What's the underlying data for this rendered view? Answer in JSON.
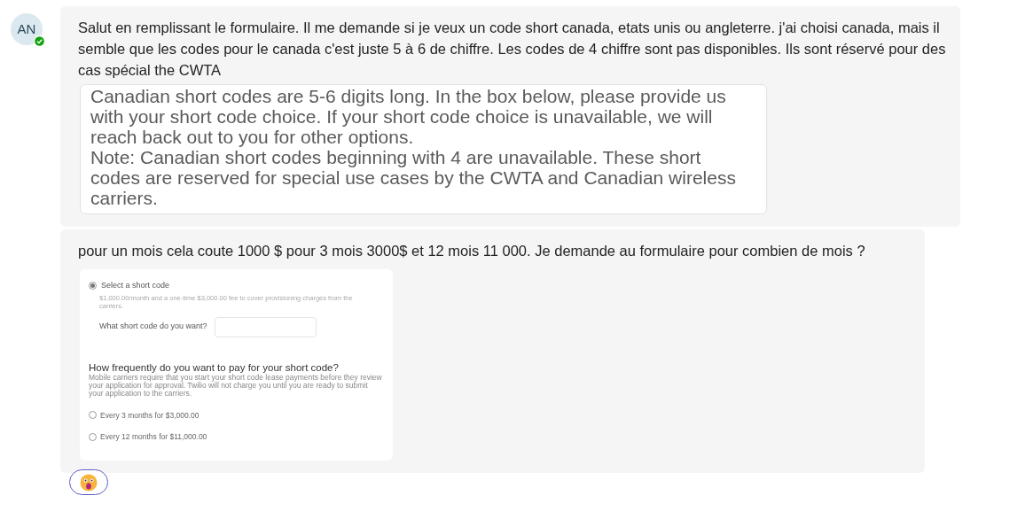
{
  "messages": [
    {
      "avatar": {
        "initials": "AN",
        "online": true
      },
      "text": "Salut en remplissant le formulaire. Il me demande si je veux un code short canada, etats unis ou angleterre. j'ai choisi canada, mais il semble que les codes pour le canada c'est juste 5 à 6 de chiffre. Les codes de 4 chiffre sont pas disponibles. Ils sont réservé pour des cas spécial the CWTA",
      "attachment": {
        "kind": "text_capture",
        "lines": [
          "Canadian short codes are 5-6 digits long. In the box below, please provide us with your short code choice. If your short code choice is unavailable, we will reach back out to you for other options.",
          "Note: Canadian short codes beginning with 4 are unavailable. These short codes are reserved for special use cases by the CWTA and Canadian wireless carriers."
        ]
      }
    },
    {
      "text": "pour un mois cela coute 1000 $ pour 3 mois 3000$ et 12 mois 11 000. Je demande au formulaire pour combien de mois ?",
      "attachment": {
        "kind": "form_capture",
        "option": {
          "label": "Select a short code",
          "selected": true,
          "description": "$1,000.00/month and a one-time $3,000.00 fee to cover provisioning charges from the carriers.",
          "field_label": "What short code do you want?"
        },
        "heading": "How frequently do you want to pay for your short code?",
        "description": "Mobile carriers require that you start your short code lease payments before they review your application for approval. Twilio will not charge you until you are ready to submit your application to the carriers.",
        "choices": [
          {
            "label": "Every 3 months for $3,000.00",
            "selected": false
          },
          {
            "label": "Every 12 months for $11,000.00",
            "selected": false
          }
        ]
      },
      "reactions": [
        {
          "kind": "surprised"
        }
      ]
    }
  ]
}
